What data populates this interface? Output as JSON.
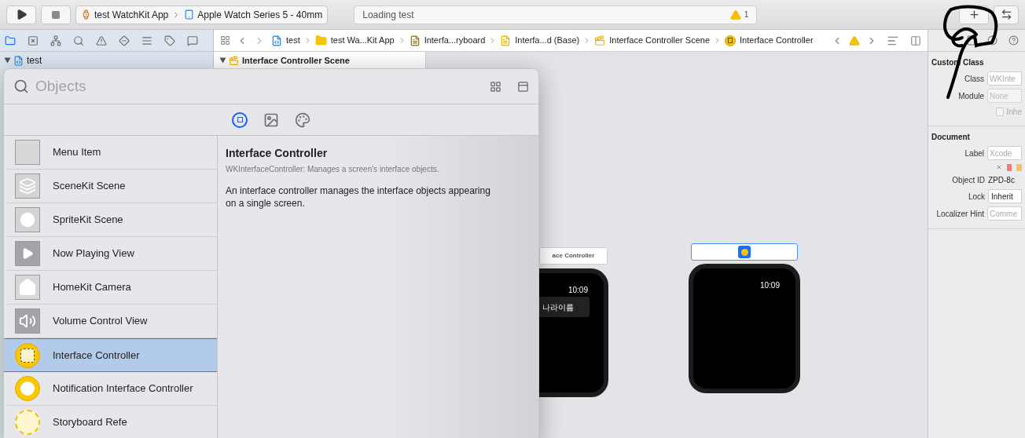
{
  "toolbar": {
    "scheme": "test WatchKit App",
    "device": "Apple Watch Series 5 - 40mm",
    "activity": "Loading test",
    "warning_count": "1"
  },
  "navigator": {
    "tabs": [
      {
        "kind": "folder",
        "selected": true
      },
      {
        "kind": "source",
        "selected": false
      },
      {
        "kind": "hierarchy",
        "selected": false
      },
      {
        "kind": "search",
        "selected": false
      },
      {
        "kind": "issue",
        "selected": false
      },
      {
        "kind": "test",
        "selected": false
      },
      {
        "kind": "debug",
        "selected": false
      },
      {
        "kind": "breakpoint",
        "selected": false
      },
      {
        "kind": "report",
        "selected": false
      }
    ],
    "tree": [
      {
        "label": "test",
        "expanded": true
      }
    ]
  },
  "jump_bar": [
    {
      "kind": "project",
      "label": "test"
    },
    {
      "kind": "folder",
      "label": "test Wa...Kit App"
    },
    {
      "kind": "storyboard",
      "label": "Interfa...ryboard"
    },
    {
      "kind": "strings",
      "label": "Interfa...d (Base)"
    },
    {
      "kind": "scene",
      "label": "Interface Controller Scene"
    },
    {
      "kind": "controller",
      "label": "Interface Controller"
    }
  ],
  "outline": {
    "label": "Interface Controller Scene",
    "expanded": true
  },
  "canvas": {
    "watches": [
      {
        "label": "ace Controller",
        "time": "10:09",
        "row": "나라이름",
        "selected": false
      },
      {
        "time": "10:09",
        "selected": true
      }
    ]
  },
  "library": {
    "search": {
      "placeholder": "Objects"
    },
    "tabs": [
      {
        "kind": "objects",
        "selected": true
      },
      {
        "kind": "media",
        "selected": false
      },
      {
        "kind": "colors",
        "selected": false
      }
    ],
    "items": [
      {
        "kind": "menu",
        "label": "Menu Item",
        "selected": false
      },
      {
        "kind": "scenekit",
        "label": "SceneKit Scene",
        "selected": false
      },
      {
        "kind": "spritekit",
        "label": "SpriteKit Scene",
        "selected": false
      },
      {
        "kind": "nowplaying",
        "label": "Now Playing View",
        "selected": false
      },
      {
        "kind": "homekit",
        "label": "HomeKit Camera",
        "selected": false
      },
      {
        "kind": "volume",
        "label": "Volume Control View",
        "selected": false
      },
      {
        "kind": "controller",
        "label": "Interface Controller",
        "selected": true
      },
      {
        "kind": "notification",
        "label": "Notification Interface Controller",
        "selected": false
      },
      {
        "kind": "storyboard",
        "label": "Storyboard Refe",
        "selected": false
      }
    ],
    "detail": {
      "title": "Interface Controller",
      "subtitle": "WKInterfaceController: Manages a screen's interface objects.",
      "description": "An interface controller manages the interface objects appearing on a single screen."
    }
  },
  "inspector": {
    "tabs": [
      {
        "kind": "file",
        "selected": false
      },
      {
        "kind": "history",
        "selected": false
      },
      {
        "kind": "help",
        "selected": false
      }
    ],
    "custom_class": {
      "title": "Custom Class",
      "class_label": "Class",
      "class_placeholder": "WKInte",
      "module_label": "Module",
      "module_placeholder": "None",
      "inherit_label": "Inhe",
      "inherit_checked": false
    },
    "document": {
      "title": "Document",
      "label_label": "Label",
      "label_placeholder": "Xcode",
      "label_colors": [
        {
          "color": "#f47b7b"
        },
        {
          "color": "#f8c35c"
        }
      ],
      "object_id_label": "Object ID",
      "object_id": "ZPD-8c",
      "lock_label": "Lock",
      "lock": "Inherit",
      "hint_label": "Localizer Hint",
      "hint_placeholder": "Comme"
    }
  }
}
